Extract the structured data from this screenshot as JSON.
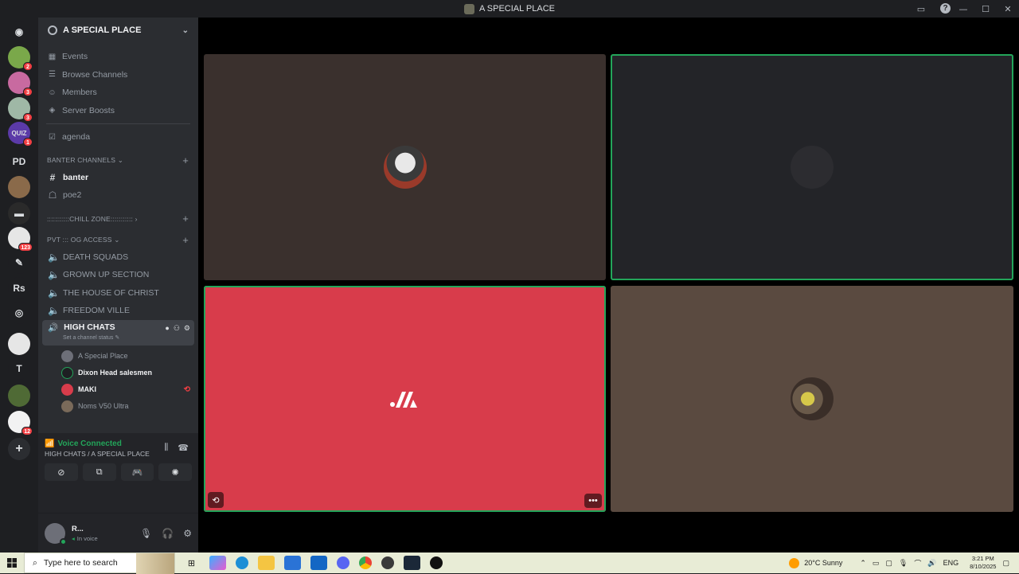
{
  "window": {
    "title": "A SPECIAL PLACE",
    "controls": [
      "—",
      "☐",
      "✕"
    ]
  },
  "rail": {
    "items": [
      {
        "name": "discord-home-icon",
        "color": "#1e1f22",
        "glyph": "◉",
        "badge": ""
      },
      {
        "name": "server-1",
        "color": "#7aa84a",
        "glyph": "",
        "badge": "2"
      },
      {
        "name": "server-2",
        "color": "#c86aa0",
        "glyph": "",
        "badge": "3"
      },
      {
        "name": "server-3",
        "color": "#9fb8a6",
        "glyph": "",
        "badge": "3"
      },
      {
        "name": "server-quiz",
        "color": "#5b3aa8",
        "glyph": "QUIZ",
        "badge": "1"
      },
      {
        "name": "server-pd",
        "color": "#1e1f22",
        "glyph": "PD",
        "badge": ""
      },
      {
        "name": "server-6",
        "color": "#8a6a4a",
        "glyph": "",
        "badge": ""
      },
      {
        "name": "server-7",
        "color": "#2a2a2a",
        "glyph": "▬",
        "badge": ""
      },
      {
        "name": "server-8",
        "color": "#e6e6e6",
        "glyph": "",
        "badge": "123"
      },
      {
        "name": "server-9",
        "color": "#1e1f22",
        "glyph": "✎",
        "badge": ""
      },
      {
        "name": "server-rs",
        "color": "#1e1f22",
        "glyph": "Rs",
        "badge": ""
      },
      {
        "name": "server-11",
        "color": "#1e1f22",
        "glyph": "◎",
        "badge": ""
      },
      {
        "name": "server-12",
        "color": "#e6e6e6",
        "glyph": "",
        "badge": ""
      },
      {
        "name": "server-t",
        "color": "#1e1f22",
        "glyph": "T",
        "badge": ""
      },
      {
        "name": "server-14",
        "color": "#4f6a35",
        "glyph": "",
        "badge": ""
      },
      {
        "name": "server-15",
        "color": "#f2f2f2",
        "glyph": "",
        "badge": "12"
      }
    ]
  },
  "sidebar": {
    "server_name": "A SPECIAL PLACE",
    "nav": [
      {
        "label": "Events",
        "icon": "▦"
      },
      {
        "label": "Browse Channels",
        "icon": "☰"
      },
      {
        "label": "Members",
        "icon": "👥"
      },
      {
        "label": "Server Boosts",
        "icon": "◈"
      }
    ],
    "agenda": "agenda",
    "banter_category": "BANTER CHANNELS",
    "banter_channels": [
      "banter",
      "poe2"
    ],
    "chill_category": ":::::::::::CHILL ZONE:::::::::::",
    "pvt_category": "PVT ::: OG ACCESS",
    "voice_channels": [
      "DEATH SQUADS",
      "GROWN UP SECTION",
      "THE HOUSE OF CHRIST",
      "FREEDOM VILLE"
    ],
    "active_channel": {
      "name": "HIGH CHATS",
      "status": "Set a channel status"
    },
    "members": [
      {
        "name": "A Special Place",
        "bright": false,
        "color": "#6d6f78"
      },
      {
        "name": "Dixon Head salesmen",
        "bright": true,
        "color": "#1e1f22"
      },
      {
        "name": "MAKI",
        "bright": true,
        "color": "#d83c4b"
      },
      {
        "name": "Noms V50 Ultra",
        "bright": false,
        "color": "#7a6a5a"
      }
    ]
  },
  "voice_panel": {
    "status": "Voice Connected",
    "location": "HIGH CHATS / A SPECIAL PLACE"
  },
  "user_panel": {
    "name": "R...",
    "status": "In voice"
  },
  "tiles": [
    {
      "name": "tile-a-special-place",
      "bg": "#3a302d",
      "avatar": "#9a8f88"
    },
    {
      "name": "tile-dixon-head",
      "bg": "#232428",
      "avatar": "#2b2b2e"
    },
    {
      "name": "tile-maki",
      "bg": "#d83c4b",
      "avatar": ""
    },
    {
      "name": "tile-noms",
      "bg": "#5a4a40",
      "avatar": "#8b7a55"
    }
  ],
  "taskbar": {
    "search_placeholder": "Type here to search",
    "weather": "20°C  Sunny",
    "lang": "ENG",
    "time": "3:21 PM",
    "date": "8/10/2025"
  }
}
